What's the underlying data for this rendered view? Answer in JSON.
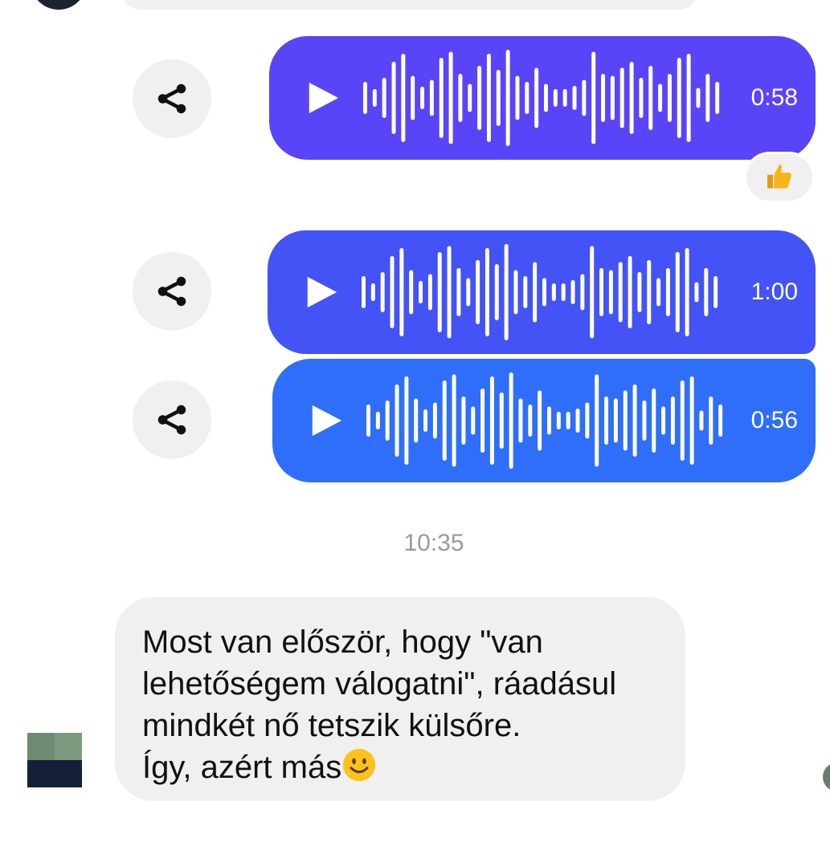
{
  "messages": {
    "voice": [
      {
        "duration": "0:58",
        "color": "#5a44f7"
      },
      {
        "duration": "1:00",
        "color": "#4353f5"
      },
      {
        "duration": "0:56",
        "color": "#2f6ef8"
      }
    ],
    "reaction_emoji": "thumbs-up",
    "timestamp": "10:35",
    "text_lines": [
      "Most van először, hogy \"van",
      "lehetőségem válogatni\", ráadásul",
      "mindkét nő tetszik külsőre.",
      "Így, azért más"
    ],
    "trailing_emoji": "smiley-face"
  },
  "icons": {
    "share": "share-icon",
    "play": "play-icon",
    "waveform": "waveform-icon"
  },
  "colors": {
    "bubble_gray": "#f0f0f0",
    "timestamp": "#9a9a9a"
  }
}
